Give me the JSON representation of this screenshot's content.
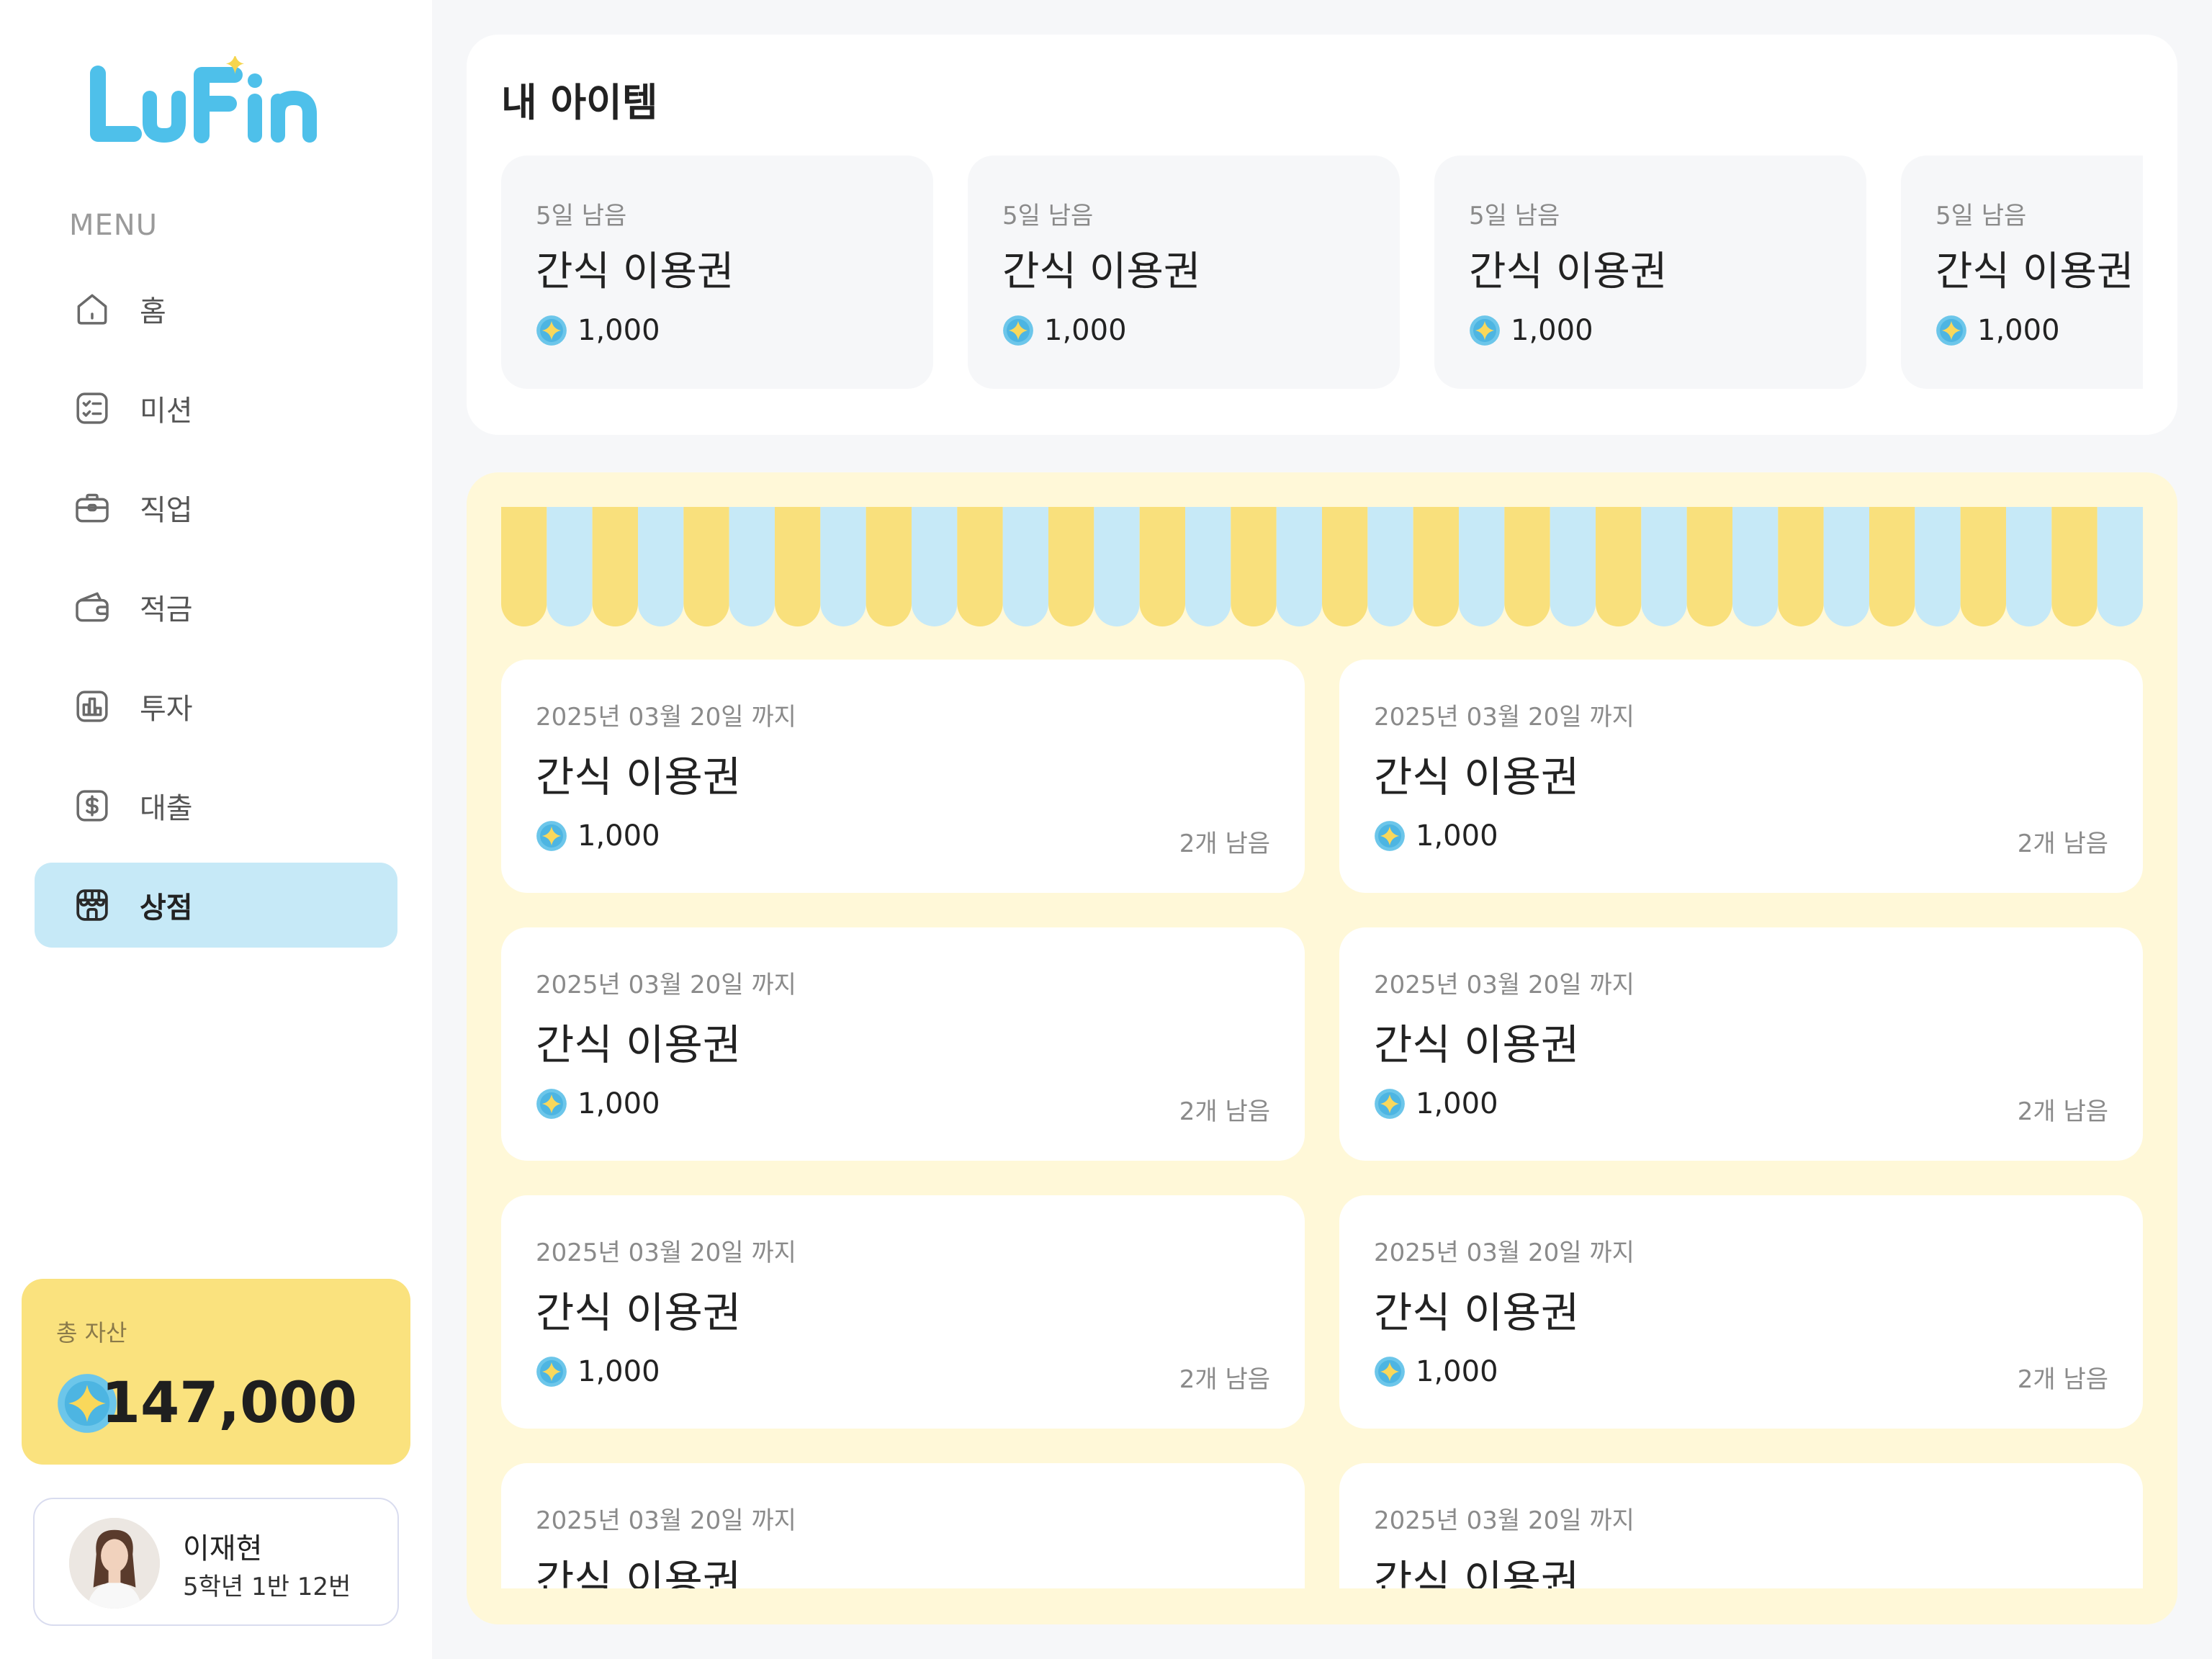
{
  "brand": {
    "name": "LuFin",
    "colors": {
      "logo": "#4ec0ea",
      "sparkle": "#f5d54e"
    }
  },
  "sidebar": {
    "menu_title": "MENU",
    "items": [
      {
        "label": "홈",
        "icon": "home-icon",
        "active": false
      },
      {
        "label": "미션",
        "icon": "checklist-icon",
        "active": false
      },
      {
        "label": "직업",
        "icon": "briefcase-icon",
        "active": false
      },
      {
        "label": "적금",
        "icon": "wallet-icon",
        "active": false
      },
      {
        "label": "투자",
        "icon": "chart-icon",
        "active": false
      },
      {
        "label": "대출",
        "icon": "dollar-icon",
        "active": false
      },
      {
        "label": "상점",
        "icon": "store-icon",
        "active": true
      }
    ]
  },
  "assets": {
    "label": "총 자산",
    "value": "147,000",
    "icon": "coin-icon"
  },
  "profile": {
    "name": "이재현",
    "class_info": "5학년 1반 12번"
  },
  "my_items": {
    "title": "내 아이템",
    "items": [
      {
        "days_left": "5일 남음",
        "name": "간식 이용권",
        "price": "1,000"
      },
      {
        "days_left": "5일 남음",
        "name": "간식 이용권",
        "price": "1,000"
      },
      {
        "days_left": "5일 남음",
        "name": "간식 이용권",
        "price": "1,000"
      },
      {
        "days_left": "5일 남음",
        "name": "간식 이용권",
        "price": "1,000"
      }
    ]
  },
  "store": {
    "colors": {
      "yellow": "#f9e07c",
      "blue": "#c6e9f7",
      "background": "#fff8d8"
    },
    "products": [
      {
        "until": "2025년 03월 20일 까지",
        "name": "간식 이용권",
        "price": "1,000",
        "stock": "2개 남음"
      },
      {
        "until": "2025년 03월 20일 까지",
        "name": "간식 이용권",
        "price": "1,000",
        "stock": "2개 남음"
      },
      {
        "until": "2025년 03월 20일 까지",
        "name": "간식 이용권",
        "price": "1,000",
        "stock": "2개 남음"
      },
      {
        "until": "2025년 03월 20일 까지",
        "name": "간식 이용권",
        "price": "1,000",
        "stock": "2개 남음"
      },
      {
        "until": "2025년 03월 20일 까지",
        "name": "간식 이용권",
        "price": "1,000",
        "stock": "2개 남음"
      },
      {
        "until": "2025년 03월 20일 까지",
        "name": "간식 이용권",
        "price": "1,000",
        "stock": "2개 남음"
      },
      {
        "until": "2025년 03월 20일 까지",
        "name": "간식 이용권",
        "price": "",
        "stock": ""
      },
      {
        "until": "2025년 03월 20일 까지",
        "name": "간식 이용권",
        "price": "",
        "stock": ""
      }
    ]
  }
}
